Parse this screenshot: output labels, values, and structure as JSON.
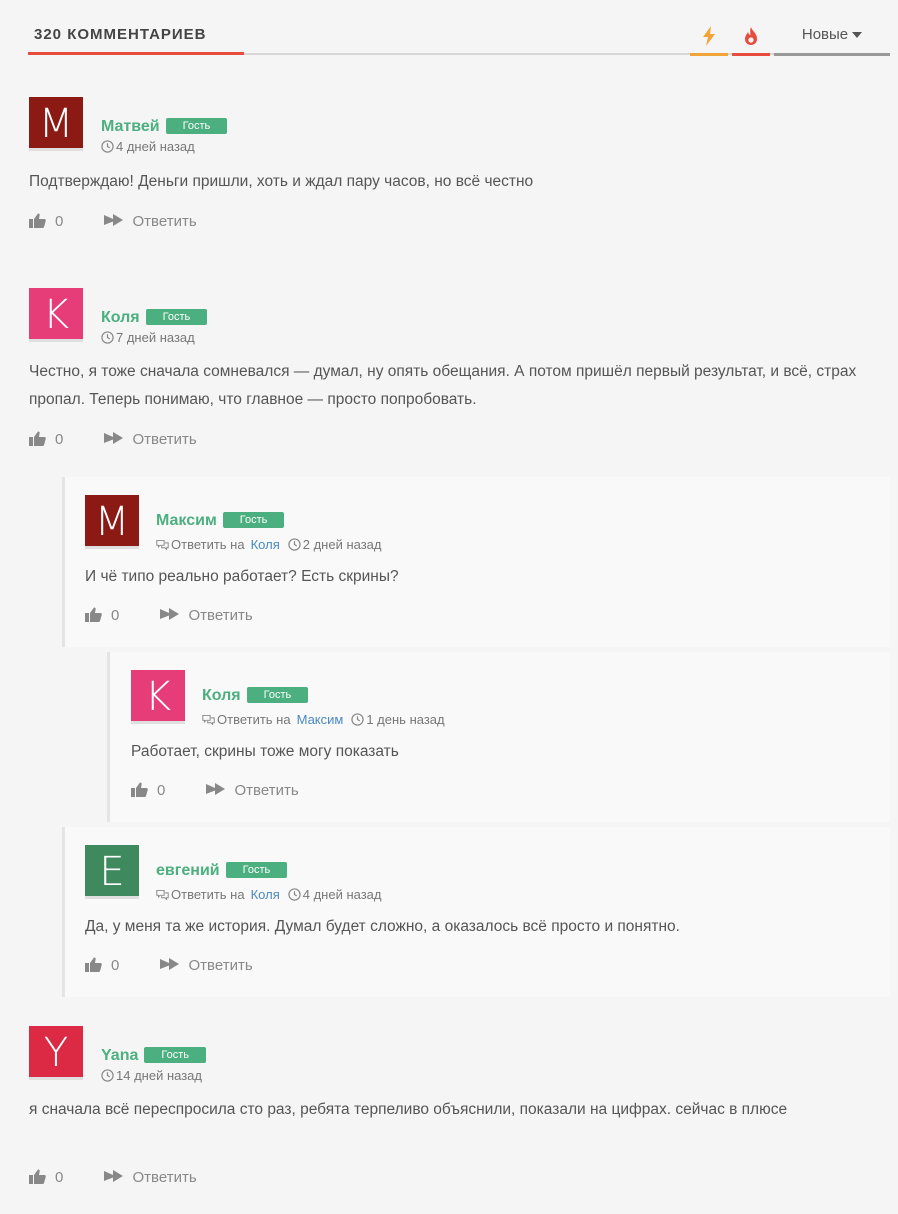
{
  "header": {
    "title": "320 КОММЕНТАРИЕВ",
    "sort_label": "Новые",
    "accent_color": "#e74c3c"
  },
  "ui": {
    "reply_label": "Ответить",
    "reply_to_label": "Ответить на",
    "guest_badge": "Гость"
  },
  "comments": [
    {
      "author": "Матвей",
      "avatar_letter": "M",
      "avatar_color": "#8b1a14",
      "time": "4 дней назад",
      "text": "Подтверждаю! Деньги пришли, хоть и ждал пару часов, но всё честно",
      "likes": "0"
    },
    {
      "author": "Коля",
      "avatar_letter": "K",
      "avatar_color": "#e63d78",
      "time": "7 дней назад",
      "text": "Честно, я тоже сначала сомневался — думал, ну опять обещания. А потом пришёл первый результат, и всё, страх пропал. Теперь понимаю, что главное — просто попробовать.",
      "likes": "0"
    },
    {
      "author": "Максим",
      "avatar_letter": "M",
      "avatar_color": "#8b1a14",
      "reply_to": "Коля",
      "time": "2 дней назад",
      "text": "И чё типо реально работает? Есть скрины?",
      "likes": "0"
    },
    {
      "author": "Коля",
      "avatar_letter": "K",
      "avatar_color": "#e63d78",
      "reply_to": "Максим",
      "time": "1 день назад",
      "text": "Работает, скрины тоже могу показать",
      "likes": "0"
    },
    {
      "author": "евгений",
      "avatar_letter": "E",
      "avatar_color": "#3e8a5e",
      "reply_to": "Коля",
      "time": "4 дней назад",
      "text": "Да, у меня та же история. Думал будет сложно, а оказалось всё просто и понятно.",
      "likes": "0"
    },
    {
      "author": "Yana",
      "avatar_letter": "Y",
      "avatar_color": "#dc2a44",
      "time": "14 дней назад",
      "text": "я сначала всё переспросила сто раз, ребята терпеливо объяснили, показали на цифрах. сейчас в плюсе",
      "likes": "0"
    }
  ]
}
